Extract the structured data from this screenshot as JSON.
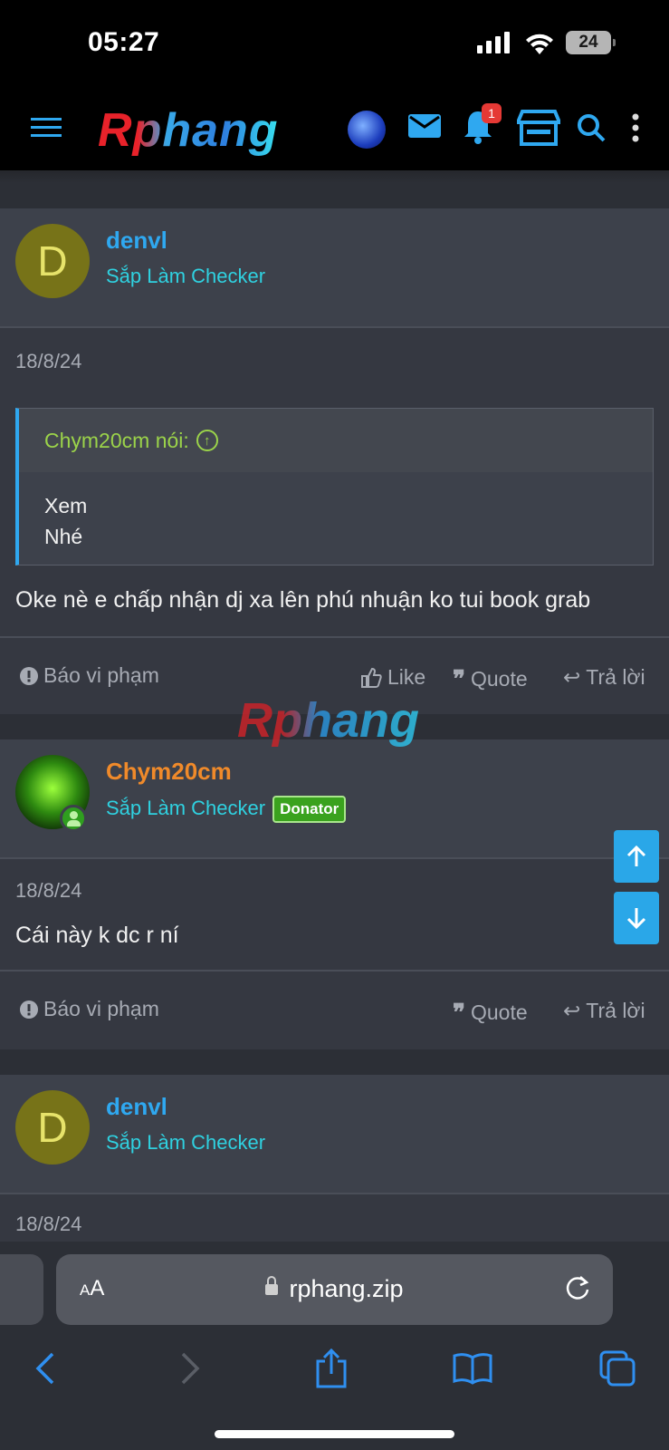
{
  "status_bar": {
    "time": "05:27",
    "battery": "24"
  },
  "nav": {
    "logo": "Rphang",
    "notification_count": "1"
  },
  "watermark": "Rphang",
  "posts": [
    {
      "author": "denvl",
      "author_color": "#2fa8f0",
      "avatar_letter": "D",
      "title": "Sắp Làm Checker",
      "date": "18/8/24",
      "quote": {
        "author": "Chym20cm nói:",
        "lines": [
          "Xem",
          "Nhé"
        ]
      },
      "text": "Oke nè e chấp nhận dj xa lên phú nhuận ko tui book grab",
      "actions": {
        "report": "Báo vi phạm",
        "like": "Like",
        "quote": "Quote",
        "reply": "Trả lời"
      }
    },
    {
      "author": "Chym20cm",
      "author_color": "#f08a2a",
      "title": "Sắp Làm Checker",
      "badge": "Donator",
      "date": "18/8/24",
      "text": "Cái này k dc r ní",
      "actions": {
        "report": "Báo vi phạm",
        "quote": "Quote",
        "reply": "Trả lời"
      }
    },
    {
      "author": "denvl",
      "author_color": "#2fa8f0",
      "avatar_letter": "D",
      "title": "Sắp Làm Checker",
      "date": "18/8/24"
    }
  ],
  "browser": {
    "aa_label_small": "A",
    "aa_label_big": "A",
    "url": "rphang.zip"
  }
}
